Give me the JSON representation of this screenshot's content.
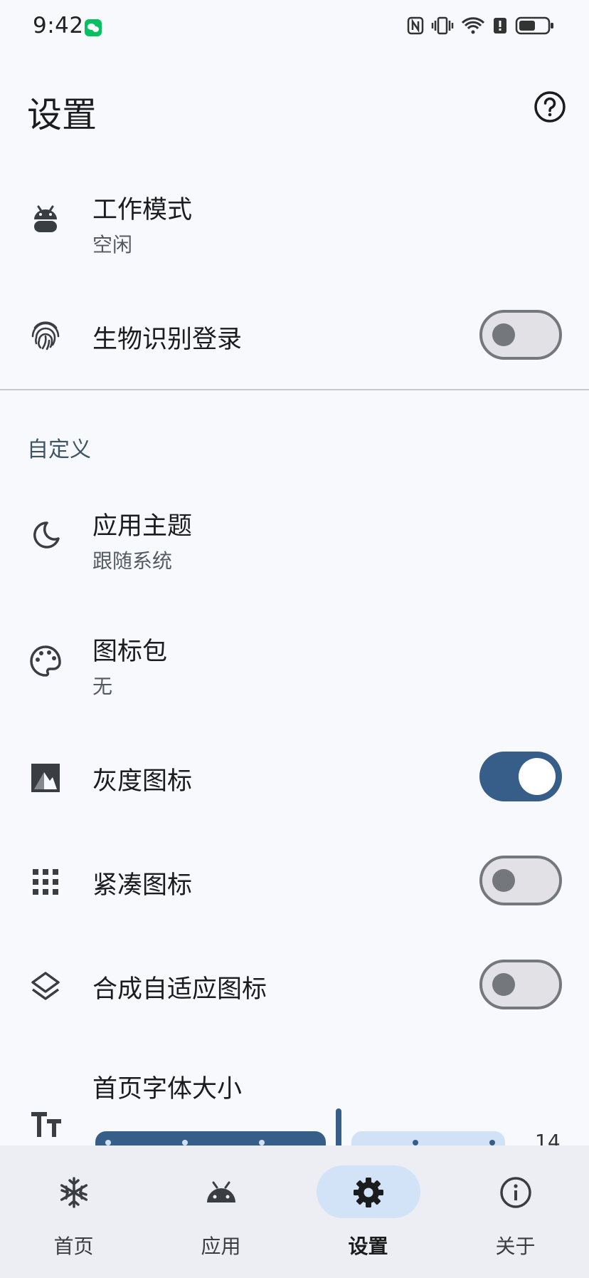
{
  "status_bar": {
    "time": "9:42",
    "icons": [
      "wechat-icon",
      "nfc-icon",
      "vibrate-icon",
      "wifi-icon",
      "alert-icon",
      "battery-icon"
    ]
  },
  "header": {
    "title": "设置",
    "help_icon": "help-circle-icon"
  },
  "general": {
    "work_mode": {
      "title": "工作模式",
      "value": "空闲",
      "icon": "android-icon"
    },
    "biometric": {
      "title": "生物识别登录",
      "icon": "fingerprint-icon",
      "enabled": false
    }
  },
  "custom": {
    "section_title": "自定义",
    "theme": {
      "title": "应用主题",
      "value": "跟随系统",
      "icon": "moon-icon"
    },
    "icon_pack": {
      "title": "图标包",
      "value": "无",
      "icon": "palette-icon"
    },
    "grayscale_icons": {
      "title": "灰度图标",
      "icon": "grayscale-image-icon",
      "enabled": true
    },
    "compact_icons": {
      "title": "紧凑图标",
      "icon": "grid-icon",
      "enabled": false
    },
    "adaptive_icons": {
      "title": "合成自适应图标",
      "icon": "layers-icon",
      "enabled": false
    },
    "font_size": {
      "title": "首页字体大小",
      "icon": "text-size-icon",
      "value": "14"
    }
  },
  "bottom_nav": {
    "items": [
      {
        "label": "首页",
        "icon": "snowflake-icon",
        "active": false
      },
      {
        "label": "应用",
        "icon": "android-icon",
        "active": false
      },
      {
        "label": "设置",
        "icon": "gear-icon",
        "active": true
      },
      {
        "label": "关于",
        "icon": "info-icon",
        "active": false
      }
    ]
  },
  "colors": {
    "accent": "#375e89",
    "background": "#f7f9fc",
    "nav_background": "#eceef3",
    "active_pill": "#d2e3f7"
  }
}
